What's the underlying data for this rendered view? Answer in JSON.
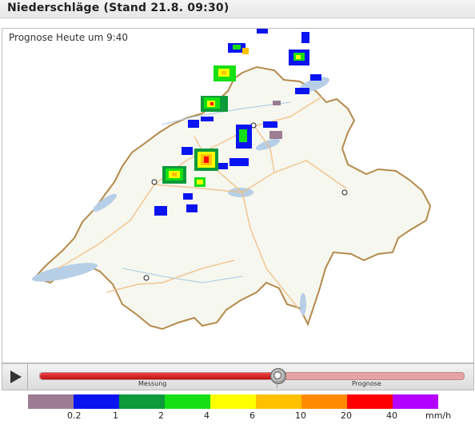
{
  "header": {
    "title": "Niederschläge (Stand 21.8. 09:30)"
  },
  "map": {
    "caption": "Prognose Heute um 9:40",
    "icons": [
      "city-marker-icon"
    ],
    "colors": {
      "land": "#f7f8f0",
      "border": "#b38a4a",
      "road": "#f2c48c",
      "lake": "#b7cfe6",
      "river": "#a9c6df"
    }
  },
  "controls": {
    "play_icon": "play-icon",
    "progress": 0.56,
    "label_measurement": "Messung",
    "label_forecast": "Prognose"
  },
  "legend": {
    "unit": "mm/h",
    "colors": [
      "#9b7c93",
      "#0a14f0",
      "#0c9a3a",
      "#14e014",
      "#ffff00",
      "#ffc000",
      "#ff8a00",
      "#ff0000",
      "#b400ff"
    ],
    "ticks": [
      "0.2",
      "1",
      "2",
      "4",
      "6",
      "10",
      "20",
      "40"
    ]
  }
}
